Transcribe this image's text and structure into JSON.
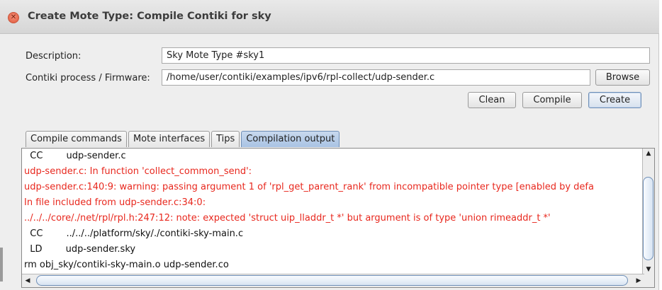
{
  "window": {
    "title": "Create Mote Type: Compile Contiki for sky"
  },
  "form": {
    "description_label": "Description:",
    "description_value": "Sky Mote Type #sky1",
    "firmware_label": "Contiki process / Firmware:",
    "firmware_value": "/home/user/contiki/examples/ipv6/rpl-collect/udp-sender.c",
    "browse_label": "Browse"
  },
  "actions": {
    "clean_label": "Clean",
    "compile_label": "Compile",
    "create_label": "Create"
  },
  "tabs": [
    {
      "label": "Compile commands",
      "active": false
    },
    {
      "label": "Mote interfaces",
      "active": false
    },
    {
      "label": "Tips",
      "active": false
    },
    {
      "label": "Compilation output",
      "active": true
    }
  ],
  "output": {
    "lines": [
      {
        "text": "  CC        udp-sender.c",
        "type": "normal"
      },
      {
        "text": "udp-sender.c: In function 'collect_common_send':",
        "type": "error"
      },
      {
        "text": "udp-sender.c:140:9: warning: passing argument 1 of 'rpl_get_parent_rank' from incompatible pointer type [enabled by defa",
        "type": "error"
      },
      {
        "text": "In file included from udp-sender.c:34:0:",
        "type": "error"
      },
      {
        "text": "../../../core/./net/rpl/rpl.h:247:12: note: expected 'struct uip_lladdr_t *' but argument is of type 'union rimeaddr_t *'",
        "type": "error"
      },
      {
        "text": "  CC        ../../../platform/sky/./contiki-sky-main.c",
        "type": "normal"
      },
      {
        "text": "  LD        udp-sender.sky",
        "type": "normal"
      },
      {
        "text": "rm obj_sky/contiki-sky-main.o udp-sender.co",
        "type": "normal"
      }
    ]
  },
  "colors": {
    "error_text": "#e8281e",
    "normal_text": "#111111",
    "accent": "#6f8fb7"
  },
  "icons": {
    "close": "close-icon",
    "scroll_up": "arrow-up-icon",
    "scroll_down": "arrow-down-icon",
    "scroll_left": "arrow-left-icon",
    "scroll_right": "arrow-right-icon"
  }
}
